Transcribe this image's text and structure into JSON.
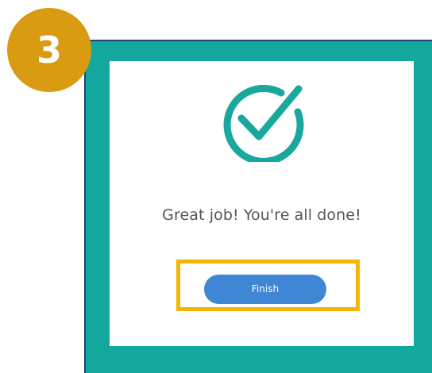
{
  "step_badge": {
    "number": "3",
    "color": "#d89b12"
  },
  "dialog": {
    "icon": "check-circle-icon",
    "message": "Great job! You're all done!",
    "finish_label": "Finish"
  },
  "colors": {
    "frame": "#12a89d",
    "check": "#1aa89e",
    "button": "#3f87d4",
    "highlight": "#f2b600"
  }
}
